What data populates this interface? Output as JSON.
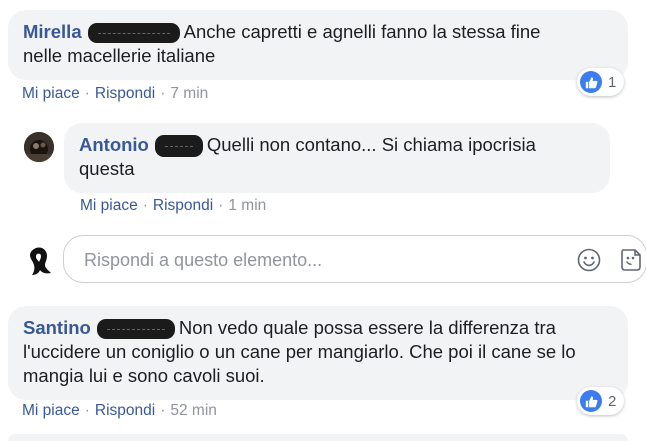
{
  "comments": [
    {
      "author": "Mirella",
      "text_line1": "Anche capretti e agnelli fanno la stessa fine",
      "text_line2": "nelle macellerie italiane",
      "like_label": "Mi piace",
      "reply_label": "Rispondi",
      "separator": "·",
      "time": "7 min",
      "reaction_count": "1"
    },
    {
      "author": "Antonio",
      "text_line1": "Quelli non contano... Si chiama ipocrisia",
      "text_line2": "questa",
      "like_label": "Mi piace",
      "reply_label": "Rispondi",
      "separator": "·",
      "time": "1 min"
    },
    {
      "author": "Santino",
      "text_line1": "Non vedo quale possa essere la differenza tra",
      "text_line2": "l'uccidere un coniglio o un cane per mangiarlo. Che poi il cane se lo",
      "text_line3": "mangia lui e sono cavoli suoi.",
      "like_label": "Mi piace",
      "reply_label": "Rispondi",
      "separator": "·",
      "time": "52 min",
      "reaction_count": "2"
    }
  ],
  "reply_box": {
    "placeholder": "Rispondi a questo elemento...",
    "emoji_icon": "smiley-icon",
    "sticker_icon": "sticker-icon"
  },
  "colors": {
    "author": "#385898",
    "bubble": "#f2f3f5",
    "meta": "#90949c",
    "like_blue": "#3b7df0"
  }
}
